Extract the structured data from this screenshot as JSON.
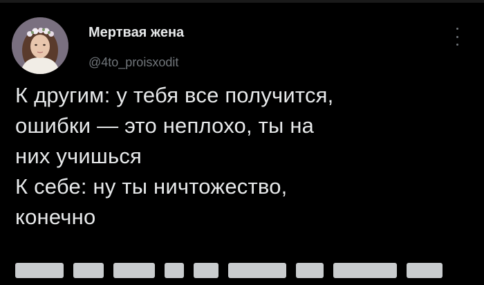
{
  "author": {
    "display_name": "Мертвая жена",
    "handle": "@4to_proisxodit",
    "avatar_icon": "profile-photo-avatar"
  },
  "menu": {
    "icon": "vertical-ellipsis-icon"
  },
  "tweet": {
    "lines": [
      "К другим: у тебя все получится,",
      "ошибки — это неплохо, ты на",
      "них учишься",
      "К себе: ну ты ничтожество,",
      "конечно"
    ]
  },
  "colors": {
    "background": "#000000",
    "primary_text": "#e7e9ea",
    "secondary_text": "#71767b"
  }
}
